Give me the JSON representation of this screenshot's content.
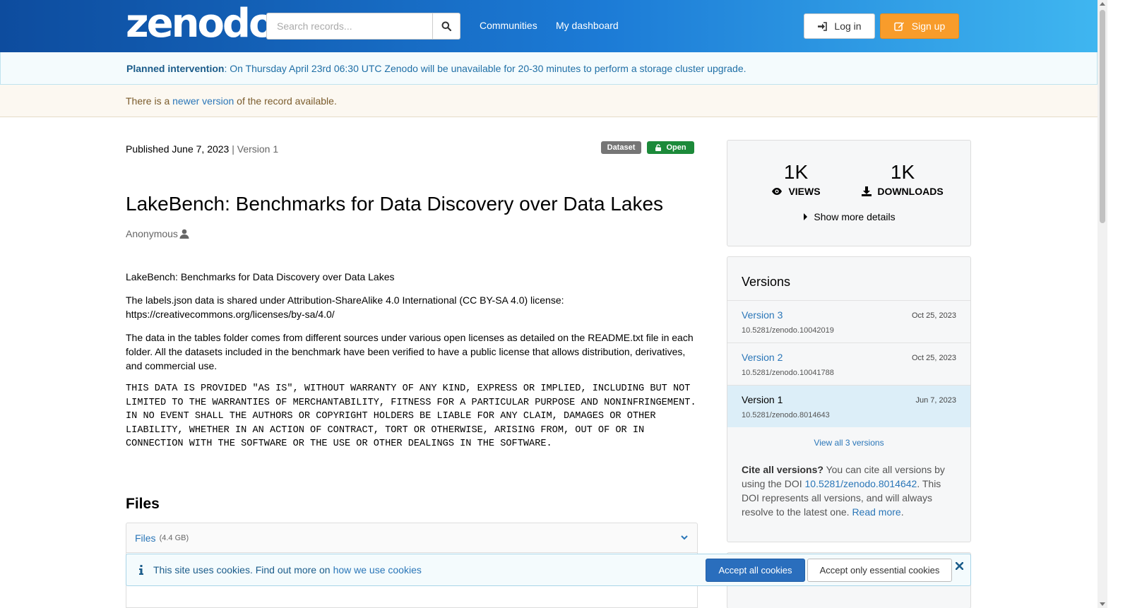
{
  "header": {
    "logo_text": "zenodo",
    "search_placeholder": "Search records...",
    "nav": [
      "Communities",
      "My dashboard"
    ],
    "login_label": "Log in",
    "signup_label": "Sign up"
  },
  "banners": {
    "intervention_title": "Planned intervention",
    "intervention_text": ": On Thursday April 23rd 06:30 UTC Zenodo will be unavailable for 20-30 minutes to perform a storage cluster upgrade.",
    "newer_prefix": "There is a ",
    "newer_link": "newer version",
    "newer_suffix": " of the record available."
  },
  "record": {
    "published": "Published June 7, 2023",
    "version": "| Version 1",
    "badge_type": "Dataset",
    "badge_access": "Open",
    "title": "LakeBench: Benchmarks for Data Discovery over Data Lakes",
    "author": "Anonymous",
    "description": [
      "LakeBench: Benchmarks for Data Discovery over Data Lakes",
      "The labels.json data is shared under Attribution-ShareAlike 4.0 International (CC BY-SA 4.0) license: https://creativecommons.org/licenses/by-sa/4.0/",
      "The data in the tables folder comes from different sources under various open licenses as detailed on the README.txt file in each folder. All the datasets included in the benchmark have been verified to have a public license that allows distribution, derivatives, and commercial use."
    ],
    "legal": "THIS DATA IS PROVIDED \"AS IS\", WITHOUT WARRANTY OF ANY KIND, EXPRESS OR IMPLIED, INCLUDING BUT NOT LIMITED TO THE WARRANTIES OF MERCHANTABILITY, FITNESS FOR A PARTICULAR PURPOSE AND NONINFRINGEMENT. IN NO EVENT SHALL THE AUTHORS OR COPYRIGHT HOLDERS BE LIABLE FOR ANY CLAIM, DAMAGES OR OTHER LIABILITY, WHETHER IN AN ACTION OF CONTRACT, TORT OR OTHERWISE, ARISING FROM, OUT OF OR IN CONNECTION WITH THE SOFTWARE OR THE USE OR OTHER DEALINGS IN THE SOFTWARE."
  },
  "files": {
    "heading": "Files",
    "accordion_label": "Files",
    "size": "(4.4 GB)"
  },
  "stats": {
    "views_value": "1K",
    "views_label": "VIEWS",
    "downloads_value": "1K",
    "downloads_label": "DOWNLOADS",
    "more_details": "Show more details"
  },
  "versions": {
    "title": "Versions",
    "items": [
      {
        "name": "Version 3",
        "date": "Oct 25, 2023",
        "doi": "10.5281/zenodo.10042019"
      },
      {
        "name": "Version 2",
        "date": "Oct 25, 2023",
        "doi": "10.5281/zenodo.10041788"
      },
      {
        "name": "Version 1",
        "date": "Jun 7, 2023",
        "doi": "10.5281/zenodo.8014643"
      }
    ],
    "view_all": "View all 3 versions",
    "cite_bold": "Cite all versions?",
    "cite_text_1": " You can cite all versions by using the DOI ",
    "cite_doi": "10.5281/zenodo.8014642",
    "cite_text_2": ". This DOI represents all versions, and will always resolve to the latest one. ",
    "read_more": "Read more",
    "period": "."
  },
  "cookies": {
    "text": "This site uses cookies. Find out more on",
    "link": "how we use cookies",
    "accept_all": "Accept all cookies",
    "accept_essential": "Accept only essential cookies"
  },
  "colors": {
    "header_start": "#0d4c9e",
    "header_end": "#3fb6f0",
    "signup": "#f89c2b",
    "open_badge": "#1c8a3a",
    "link": "#2a76b8",
    "accept_all": "#2a6ebd"
  }
}
